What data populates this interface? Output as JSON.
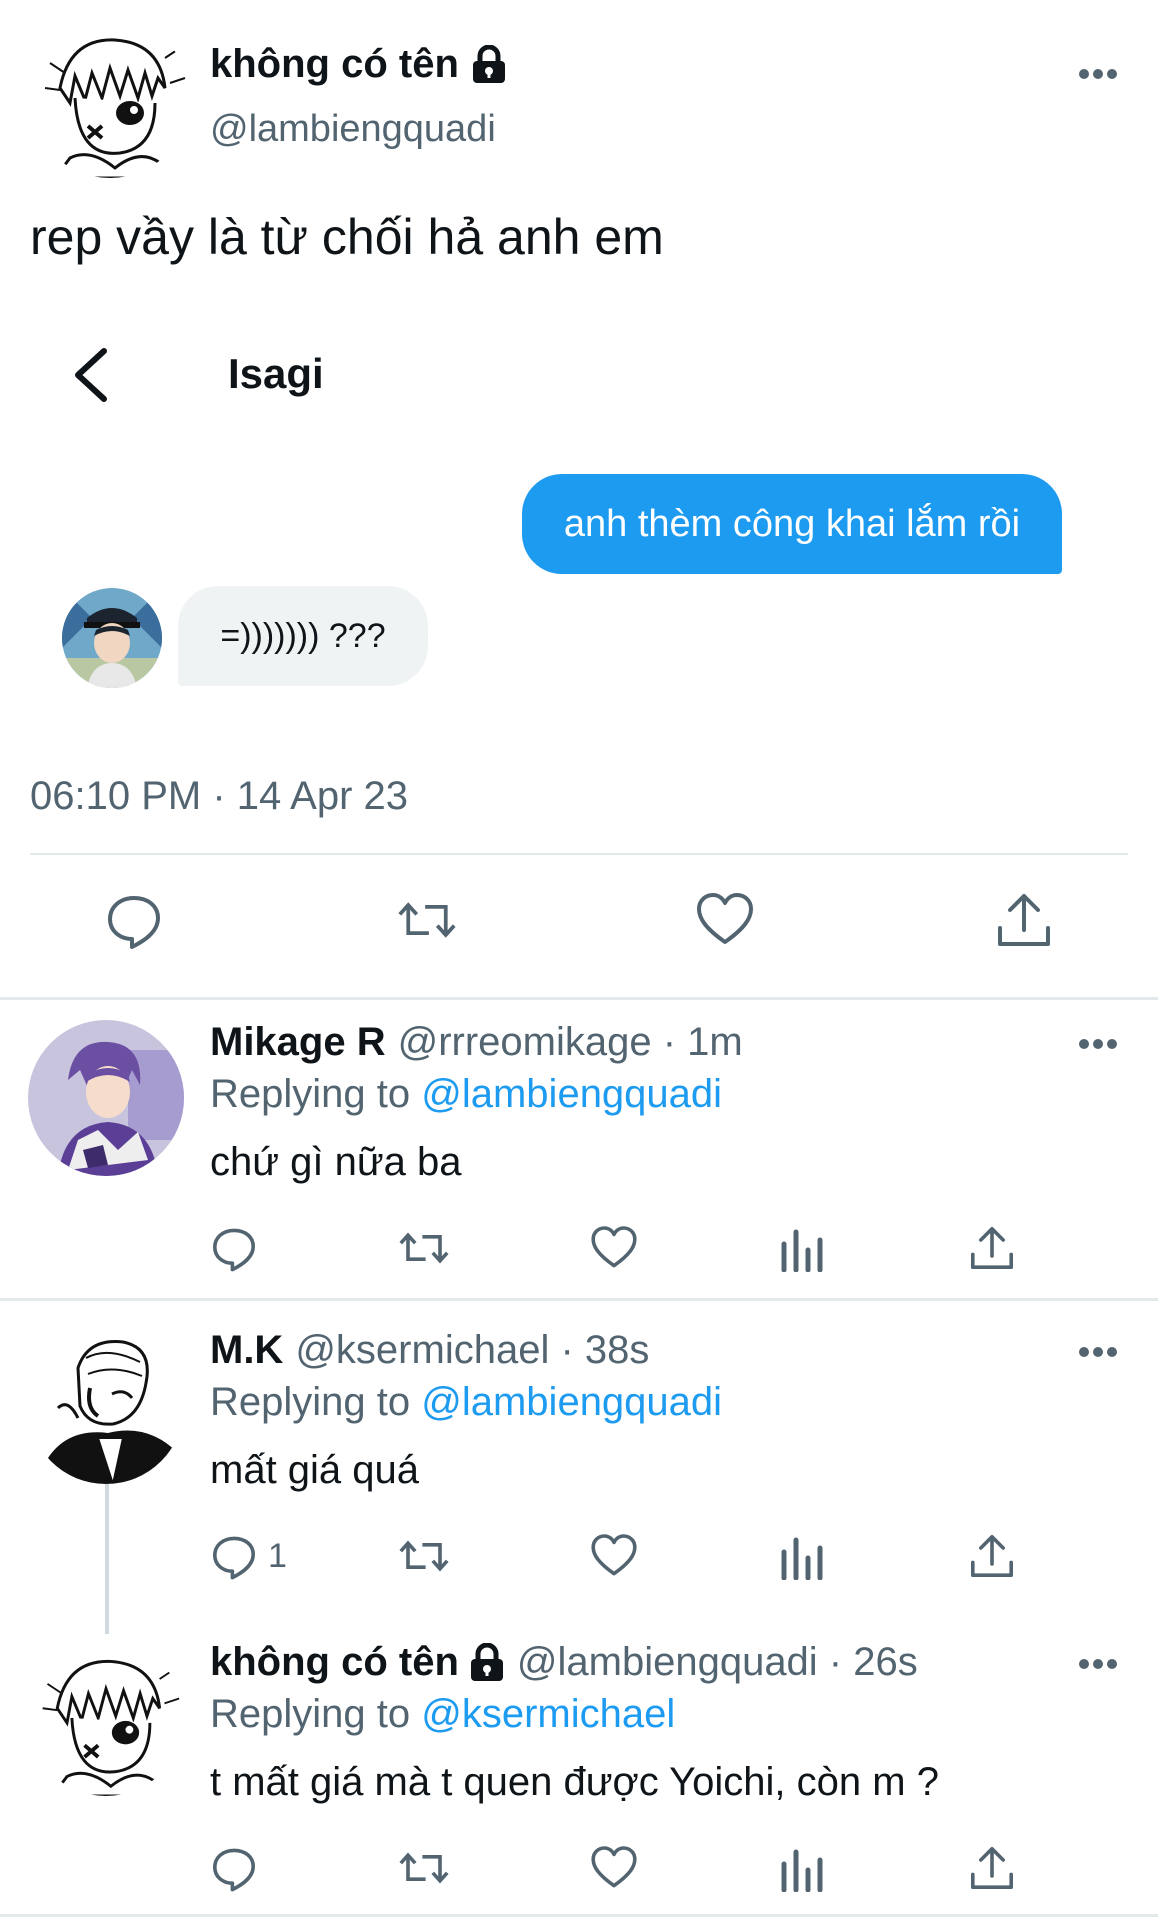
{
  "main_tweet": {
    "display_name": "không có tên",
    "handle": "@lambiengquadi",
    "text": "rep vầy là từ chối hả anh em",
    "icons": [
      "lock-icon",
      "more-icon"
    ],
    "dm": {
      "title": "Isagi",
      "outgoing_message": "anh thèm công khai lắm rồi",
      "incoming_message": "=))))))) ???"
    },
    "timestamp": "06:10 PM · 14 Apr 23",
    "actions": [
      "reply-icon",
      "retweet-icon",
      "like-icon",
      "share-icon"
    ]
  },
  "replies": [
    {
      "display_name": "Mikage R",
      "meta": "@rrreomikage · 1m",
      "replying_prefix": "Replying to",
      "replying_to": "@lambiengquadi",
      "text": "chứ gì nữa ba",
      "reply_count": ""
    },
    {
      "display_name": "M.K",
      "meta": "@ksermichael · 38s",
      "replying_prefix": "Replying to",
      "replying_to": "@lambiengquadi",
      "text": "mất giá quá",
      "reply_count": "1"
    },
    {
      "display_name": "không có tên",
      "meta": "@lambiengquadi · 26s",
      "replying_prefix": "Replying to",
      "replying_to": "@ksermichael",
      "text": "t mất giá mà t quen được Yoichi, còn m ?",
      "reply_count": ""
    }
  ],
  "colors": {
    "accent": "#1d9bf0",
    "text_primary": "#0f1419",
    "text_secondary": "#536471",
    "divider": "#e3e8eb",
    "bubble_in": "#eff3f4"
  }
}
